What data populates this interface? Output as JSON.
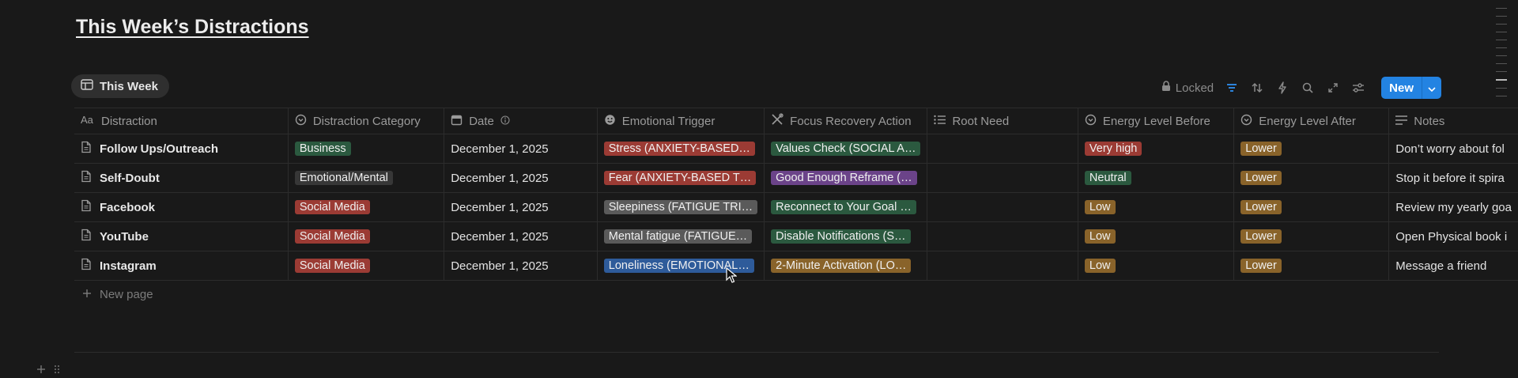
{
  "page": {
    "title": "This Week’s Distractions"
  },
  "view": {
    "tab_label": "This Week"
  },
  "toolbar": {
    "locked_label": "Locked",
    "new_label": "New"
  },
  "columns": [
    {
      "label": "Distraction",
      "icon": "text-aa-icon"
    },
    {
      "label": "Distraction Category",
      "icon": "select-icon"
    },
    {
      "label": "Date",
      "icon": "calendar-icon"
    },
    {
      "label": "Emotional Trigger",
      "icon": "face-icon"
    },
    {
      "label": "Focus Recovery Action",
      "icon": "crossed-tools-icon"
    },
    {
      "label": "Root Need",
      "icon": "list-icon"
    },
    {
      "label": "Energy Level Before",
      "icon": "select-icon"
    },
    {
      "label": "Energy Level After",
      "icon": "select-icon"
    },
    {
      "label": "Notes",
      "icon": "lines-icon"
    }
  ],
  "rows": [
    {
      "name": "Follow Ups/Outreach",
      "category": "Business",
      "category_color": "#2b593f",
      "date": "December 1, 2025",
      "trigger": "Stress (ANXIETY-BASED…",
      "trigger_color": "#9b3b34",
      "recovery": "Values Check (SOCIAL A…",
      "recovery_color": "#2b593f",
      "root_need": "",
      "before": "Very high",
      "before_color": "#9b3b34",
      "after": "Lower",
      "after_color": "#89632a",
      "notes": "Don’t worry about fol"
    },
    {
      "name": "Self-Doubt",
      "category": "Emotional/Mental",
      "category_color": "#373737",
      "date": "December 1, 2025",
      "trigger": "Fear (ANXIETY-BASED T…",
      "trigger_color": "#9b3b34",
      "recovery": "Good Enough Reframe (…",
      "recovery_color": "#6b4389",
      "root_need": "",
      "before": "Neutral",
      "before_color": "#2b593f",
      "after": "Lower",
      "after_color": "#89632a",
      "notes": "Stop it before it spira"
    },
    {
      "name": "Facebook",
      "category": "Social Media",
      "category_color": "#9b3b34",
      "date": "December 1, 2025",
      "trigger": "Sleepiness (FATIGUE TRI…",
      "trigger_color": "#5a5a5a",
      "recovery": "Reconnect to Your Goal …",
      "recovery_color": "#2b593f",
      "root_need": "",
      "before": "Low",
      "before_color": "#89632a",
      "after": "Lower",
      "after_color": "#89632a",
      "notes": "Review my yearly goa"
    },
    {
      "name": "YouTube",
      "category": "Social Media",
      "category_color": "#9b3b34",
      "date": "December 1, 2025",
      "trigger": "Mental fatigue (FATIGUE…",
      "trigger_color": "#5a5a5a",
      "recovery": "Disable Notifications (S…",
      "recovery_color": "#2b593f",
      "root_need": "",
      "before": "Low",
      "before_color": "#89632a",
      "after": "Lower",
      "after_color": "#89632a",
      "notes": "Open Physical book i"
    },
    {
      "name": "Instagram",
      "category": "Social Media",
      "category_color": "#9b3b34",
      "date": "December 1, 2025",
      "trigger": "Loneliness (EMOTIONAL…",
      "trigger_color": "#2e5b9a",
      "recovery": "2-Minute Activation (LO…",
      "recovery_color": "#89632a",
      "root_need": "",
      "before": "Low",
      "before_color": "#89632a",
      "after": "Lower",
      "after_color": "#89632a",
      "notes": "Message a friend"
    }
  ],
  "footer": {
    "new_page_label": "New page"
  }
}
